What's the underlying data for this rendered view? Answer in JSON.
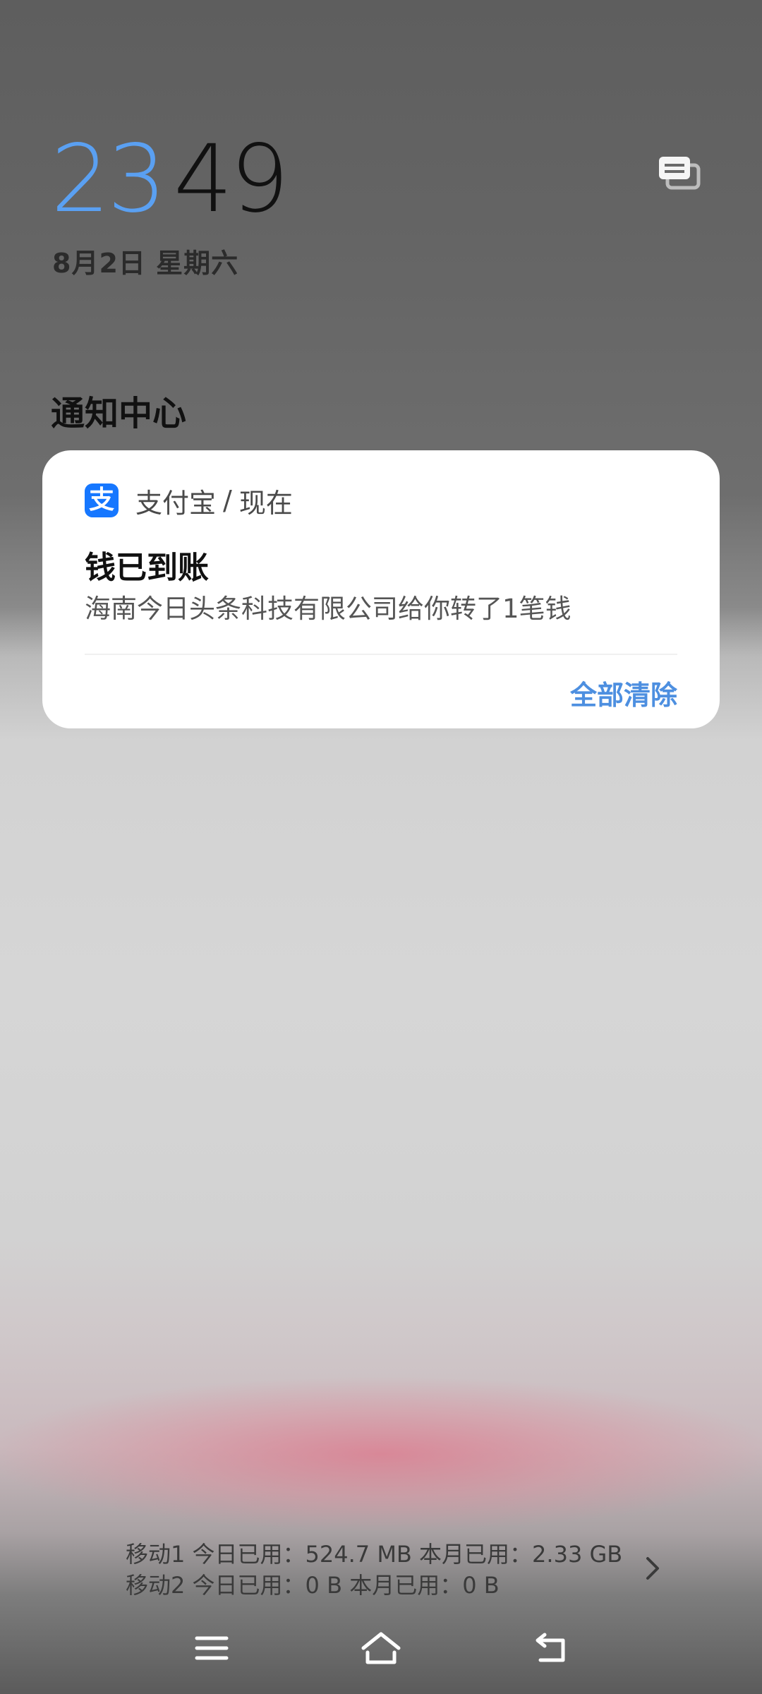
{
  "lockscreen": {
    "clock": {
      "hours": "23",
      "minutes": "49"
    },
    "date": "8月2日 星期六",
    "accent_color": "#5aa0f2"
  },
  "notification_center": {
    "title": "通知中心",
    "notifications": [
      {
        "app_name": "支付宝",
        "app_icon": "alipay-icon",
        "app_icon_glyph": "支",
        "app_icon_color": "#1677ff",
        "separator": "/",
        "time": "现在",
        "title": "钱已到账",
        "body": "海南今日头条科技有限公司给你转了1笔钱"
      }
    ],
    "clear_all_label": "全部清除"
  },
  "data_usage": {
    "line1": "移动1 今日已用：524.7 MB 本月已用：2.33 GB",
    "line2": "移动2 今日已用：0 B 本月已用：0 B"
  },
  "navbar": {
    "buttons": [
      "menu-icon",
      "home-icon",
      "back-icon"
    ]
  }
}
